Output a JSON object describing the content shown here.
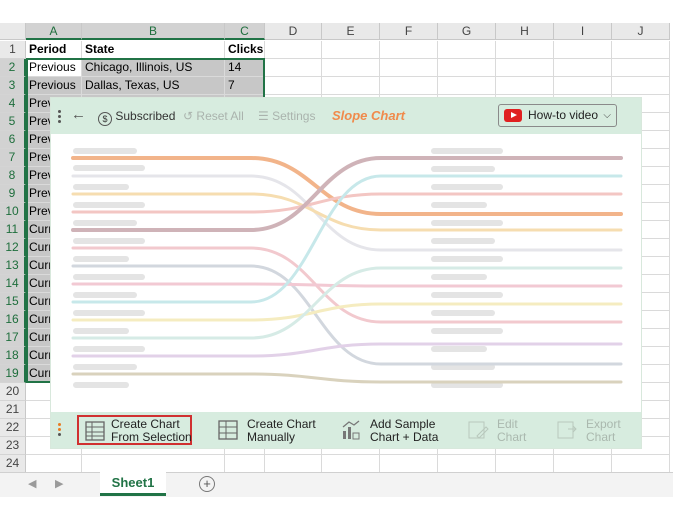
{
  "sheet": {
    "columns": [
      "A",
      "B",
      "C",
      "D",
      "E",
      "F",
      "G",
      "H",
      "I",
      "J"
    ],
    "rows": [
      "1",
      "2",
      "3",
      "4",
      "5",
      "6",
      "7",
      "8",
      "9",
      "10",
      "11",
      "12",
      "13",
      "14",
      "15",
      "16",
      "17",
      "18",
      "19",
      "20",
      "21",
      "22",
      "23",
      "24"
    ],
    "header_row": {
      "a": "Period",
      "b": "State",
      "c": "Clicks"
    },
    "data_rows": [
      {
        "a": "Previous",
        "b": "Chicago, Illinois, US",
        "c": "14"
      },
      {
        "a": "Previous",
        "b": "Dallas, Texas, US",
        "c": "7"
      },
      {
        "a": "Prev"
      },
      {
        "a": "Prev"
      },
      {
        "a": "Prev"
      },
      {
        "a": "Prev"
      },
      {
        "a": "Prev"
      },
      {
        "a": "Prev"
      },
      {
        "a": "Prev"
      },
      {
        "a": "Curr"
      },
      {
        "a": "Curr"
      },
      {
        "a": "Curr"
      },
      {
        "a": "Curr"
      },
      {
        "a": "Curr"
      },
      {
        "a": "Curr"
      },
      {
        "a": "Curr"
      },
      {
        "a": "Curr"
      },
      {
        "a": "Curr"
      }
    ],
    "tab_name": "Sheet1",
    "add_sheet": "+"
  },
  "panel": {
    "toolbar": {
      "back_icon": "arrow-left-icon",
      "subscribed": "Subscribed",
      "reset_all": "Reset All",
      "settings": "Settings",
      "title": "Slope Chart",
      "howto": "How-to video"
    },
    "actions": {
      "create_selection_1": "Create Chart",
      "create_selection_2": "From Selection",
      "create_manual_1": "Create Chart",
      "create_manual_2": "Manually",
      "sample_1": "Add Sample",
      "sample_2": "Chart + Data",
      "edit_1": "Edit",
      "edit_2": "Chart",
      "export_1": "Export",
      "export_2": "Chart"
    },
    "colors": {
      "accent": "#217346",
      "panel_bg": "#d7ecdf",
      "title": "#f08a4b",
      "highlight": "#d03030"
    }
  }
}
